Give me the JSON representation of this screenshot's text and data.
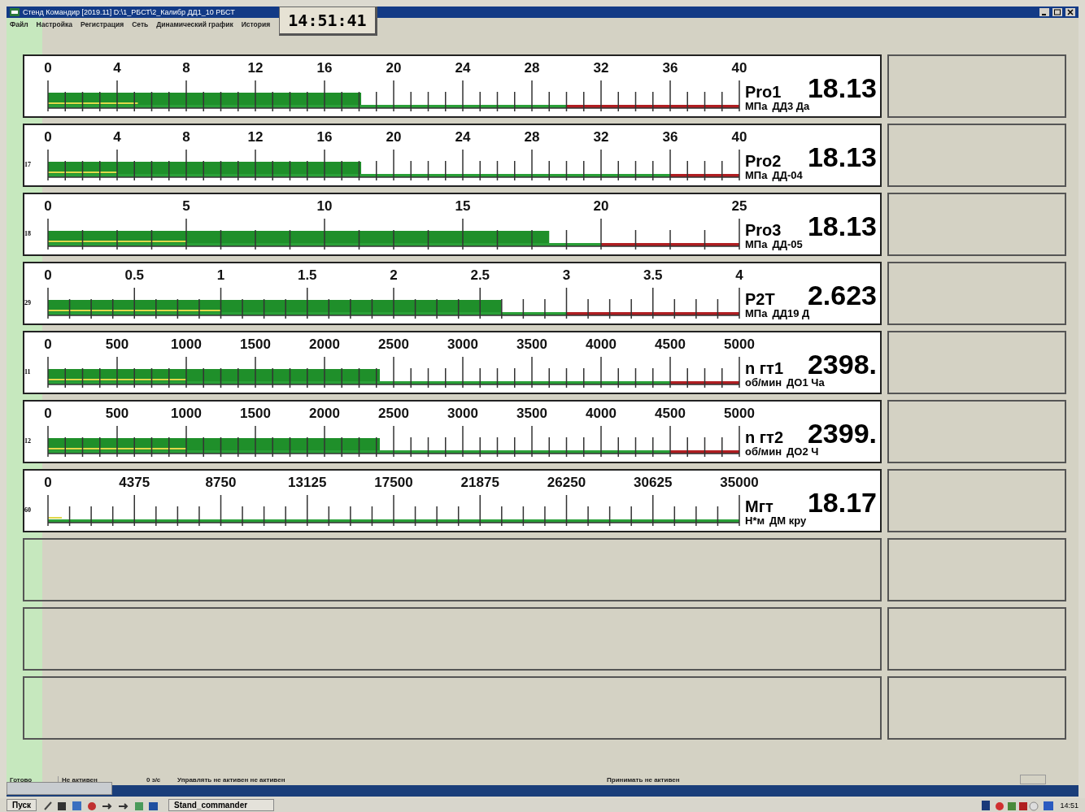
{
  "window": {
    "title": "Стенд Командир [2019.11] D:\\1_РБСТ\\2_Калибр ДД1_10 РБСТ"
  },
  "menu": [
    "Файл",
    "Настройка",
    "Регистрация",
    "Сеть",
    "Динамический график",
    "История"
  ],
  "clock": "14:51:41",
  "gauges": [
    {
      "name": "Pro1",
      "value": "18.13",
      "unit": "МПа",
      "sensor": "ДД3 Да",
      "scale": [
        "0",
        "4",
        "8",
        "12",
        "16",
        "20",
        "24",
        "28",
        "32",
        "36",
        "40"
      ],
      "bar": {
        "level": 0.453
      },
      "reference": {
        "level": 0.13
      },
      "warning_zone": {
        "level": 0.25
      }
    },
    {
      "channel_number": "17",
      "name": "Pro2",
      "value": "18.13",
      "unit": "МПа",
      "sensor": "ДД-04",
      "scale": [
        "0",
        "4",
        "8",
        "12",
        "16",
        "20",
        "24",
        "28",
        "32",
        "36",
        "40"
      ],
      "bar": {
        "level": 0.453
      },
      "reference": {
        "level": 0.1
      },
      "warning_zone": {
        "level": 0.1
      }
    },
    {
      "channel_number": "18",
      "name": "Pro3",
      "value": "18.13",
      "unit": "МПа",
      "sensor": "ДД-05",
      "scale": [
        "0",
        "5",
        "10",
        "15",
        "20",
        "25"
      ],
      "bar": {
        "level": 0.725
      },
      "reference": {
        "level": 0.2
      },
      "warning_zone": {
        "level": 0.2
      }
    },
    {
      "channel_number": "29",
      "name": "P2T",
      "value": "2.623",
      "unit": "МПа",
      "sensor": "ДД19 Д",
      "scale": [
        "0",
        "0.5",
        "1",
        "1.5",
        "2",
        "2.5",
        "3",
        "3.5",
        "4"
      ],
      "bar": {
        "level": 0.656
      },
      "reference": {
        "level": 0.25
      },
      "warning_zone": {
        "level": 0.25
      }
    },
    {
      "channel_number": "11",
      "name": "n гт1",
      "value": "2398.",
      "unit": "об/мин",
      "sensor": "ДО1 Ча",
      "scale": [
        "0",
        "500",
        "1000",
        "1500",
        "2000",
        "2500",
        "3000",
        "3500",
        "4000",
        "4500",
        "5000"
      ],
      "bar": {
        "level": 0.48
      },
      "reference": {
        "level": 0.2
      },
      "warning_zone": {
        "level": 0.1
      }
    },
    {
      "channel_number": "12",
      "name": "n гт2",
      "value": "2399.",
      "unit": "об/мин",
      "sensor": "ДО2 Ч",
      "scale": [
        "0",
        "500",
        "1000",
        "1500",
        "2000",
        "2500",
        "3000",
        "3500",
        "4000",
        "4500",
        "5000"
      ],
      "bar": {
        "level": 0.48
      },
      "reference": {
        "level": 0.2
      },
      "warning_zone": {
        "level": 0.1
      }
    },
    {
      "channel_number": "60",
      "name": "Мгт",
      "value": "18.17",
      "unit": "Н*м",
      "sensor": "ДМ кру",
      "scale": [
        "0",
        "4375",
        "8750",
        "13125",
        "17500",
        "21875",
        "26250",
        "30625",
        "35000"
      ],
      "reference": {
        "level": 0.02
      }
    }
  ],
  "status_bar": [
    "Готово",
    "Не активен",
    "0 з/с",
    "Управлять не активен не активен",
    "Принимать не активен"
  ],
  "taskbar": {
    "start": "Пуск",
    "task": "Stand_commander",
    "time": "14:51"
  }
}
